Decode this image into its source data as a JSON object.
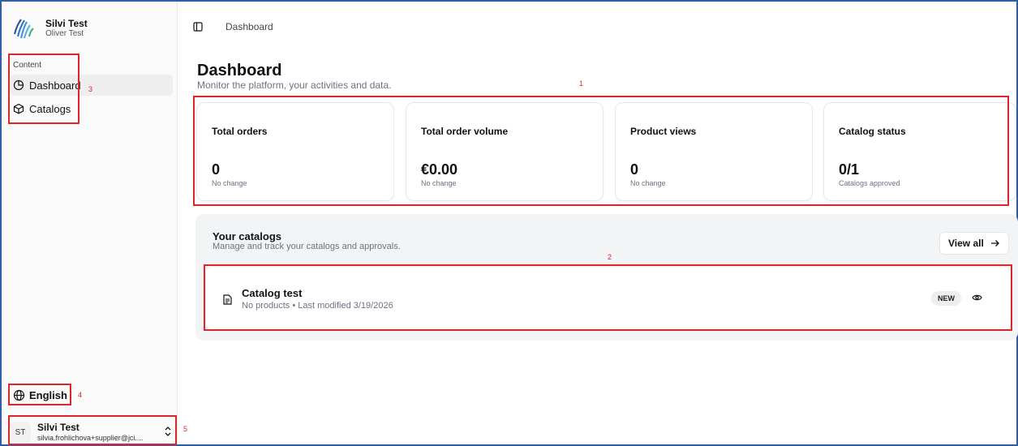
{
  "brand": {
    "name": "Silvi Test",
    "subtitle": "Oliver Test"
  },
  "sidebar": {
    "section_label": "Content",
    "items": [
      {
        "label": "Dashboard",
        "icon": "chart-pie-icon",
        "active": true
      },
      {
        "label": "Catalogs",
        "icon": "box-icon",
        "active": false
      }
    ],
    "language": {
      "label": "English",
      "icon": "globe-icon"
    },
    "user": {
      "initials": "ST",
      "name": "Silvi Test",
      "email": "silvia.frohlichova+supplier@jci...."
    }
  },
  "topbar": {
    "breadcrumb": "Dashboard",
    "toggle_icon": "sidebar-toggle-icon"
  },
  "page": {
    "title": "Dashboard",
    "subtitle": "Monitor the platform, your activities and data."
  },
  "stats": [
    {
      "title": "Total orders",
      "value": "0",
      "note": "No change"
    },
    {
      "title": "Total order volume",
      "value": "€0.00",
      "note": "No change"
    },
    {
      "title": "Product views",
      "value": "0",
      "note": "No change"
    },
    {
      "title": "Catalog status",
      "value": "0/1",
      "note": "Catalogs approved"
    }
  ],
  "catalogs": {
    "title": "Your catalogs",
    "subtitle": "Manage and track your catalogs and approvals.",
    "view_all_label": "View all",
    "items": [
      {
        "title": "Catalog test",
        "subtitle": "No products • Last modified 3/19/2026",
        "badge": "NEW"
      }
    ]
  },
  "annotations": [
    "1",
    "2",
    "3",
    "4",
    "5"
  ],
  "colors": {
    "annotation": "#e0242b",
    "frame": "#2f5fa7",
    "panel_bg": "#f3f4f6"
  }
}
